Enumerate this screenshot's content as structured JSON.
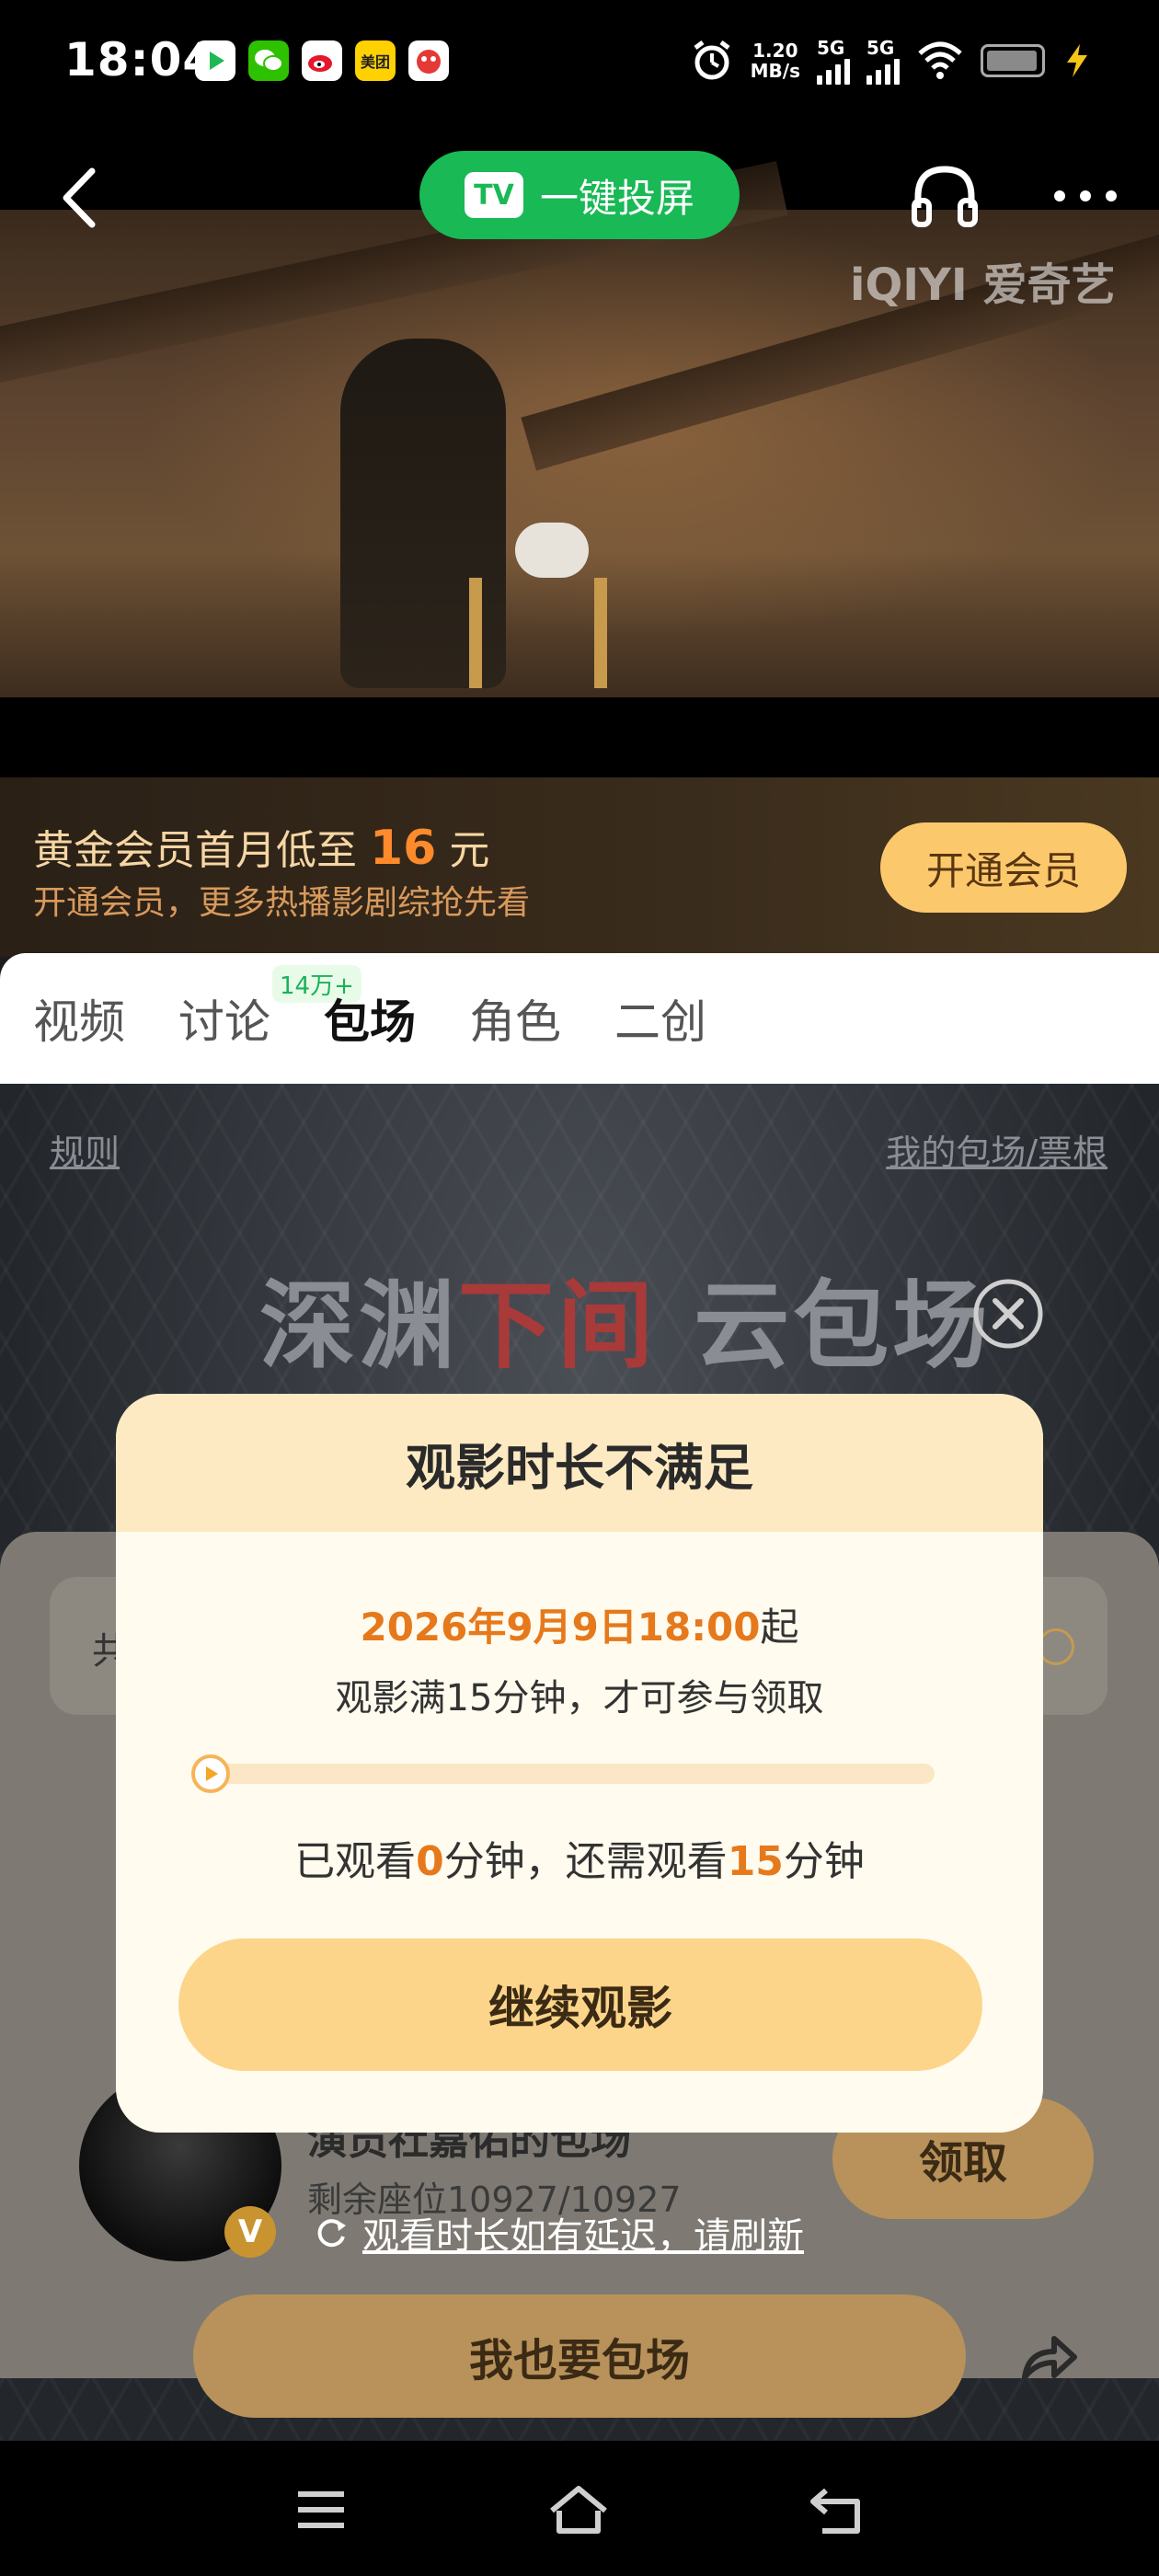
{
  "status_bar": {
    "time": "18:04",
    "net_speed_value": "1.20",
    "net_speed_unit": "MB/s",
    "sim1": "5G",
    "sim2": "5G",
    "app_icons": [
      "video-app-icon",
      "wechat-icon",
      "weibo-icon",
      "meituan-icon",
      "game-app-icon"
    ],
    "meituan_label": "美团"
  },
  "player": {
    "cast_button_label": "一键投屏",
    "tv_badge": "TV",
    "watermark": "iQIYI 爱奇艺"
  },
  "banner": {
    "title_prefix": "黄金会员首月低至 ",
    "price": "16",
    "title_suffix": " 元",
    "subtitle": "开通会员，更多热播影剧综抢先看",
    "button_label": "开通会员"
  },
  "tabs": [
    {
      "label": "视频"
    },
    {
      "label": "讨论",
      "badge": "14万+"
    },
    {
      "label": "包场"
    },
    {
      "label": "角色"
    },
    {
      "label": "二创"
    }
  ],
  "page": {
    "rules_link": "规则",
    "my_tickets_link": "我的包场/票根",
    "hero_title_part1": "深渊",
    "hero_title_part2": "下间",
    "hero_title_part3": " 云包场",
    "inner_field_char": "共",
    "host_name": "演员社嘉佑的包场",
    "seats": "剩余座位10927/10927",
    "claim_button": "领取",
    "refresh_text": "观看时长如有延迟，请刷新",
    "big_button": "我也要包场",
    "avatar_badge": "V"
  },
  "modal": {
    "title": "观影时长不满足",
    "date": "2026年9月9日18:00",
    "date_suffix": "起",
    "condition": "观影满15分钟，才可参与领取",
    "watched_prefix": "已观看",
    "watched_minutes": "0",
    "watched_mid": "分钟，还需观看",
    "remaining_minutes": "15",
    "watched_suffix": "分钟",
    "progress": 0,
    "button_label": "继续观影"
  },
  "colors": {
    "cast_green": "#19b955",
    "accent_orange": "#e5791c",
    "gold": "#fbc96c"
  }
}
